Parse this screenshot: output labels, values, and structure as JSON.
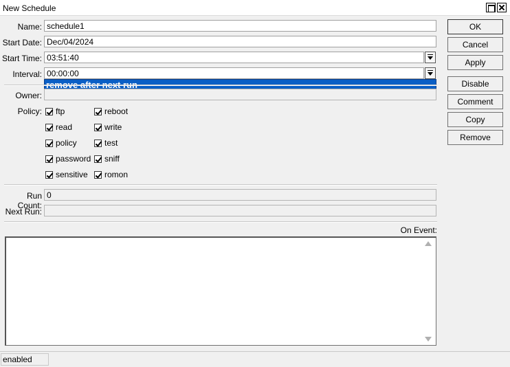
{
  "window": {
    "title": "New Schedule"
  },
  "form": {
    "name": {
      "label": "Name:",
      "value": "schedule1"
    },
    "start_date": {
      "label": "Start Date:",
      "value": "Dec/04/2024"
    },
    "start_time": {
      "label": "Start Time:",
      "value": "03:51:40"
    },
    "interval": {
      "label": "Interval:",
      "value": "00:00:00"
    },
    "interval_option": "remove after next run",
    "owner": {
      "label": "Owner:",
      "value": ""
    },
    "policy": {
      "label": "Policy:",
      "items": [
        {
          "label": "ftp",
          "checked": true
        },
        {
          "label": "reboot",
          "checked": true
        },
        {
          "label": "read",
          "checked": true
        },
        {
          "label": "write",
          "checked": true
        },
        {
          "label": "policy",
          "checked": true
        },
        {
          "label": "test",
          "checked": true
        },
        {
          "label": "password",
          "checked": true
        },
        {
          "label": "sniff",
          "checked": true
        },
        {
          "label": "sensitive",
          "checked": true
        },
        {
          "label": "romon",
          "checked": true
        }
      ]
    },
    "run_count": {
      "label": "Run Count:",
      "value": "0"
    },
    "next_run": {
      "label": "Next Run:",
      "value": ""
    },
    "on_event": {
      "label": "On Event:",
      "value": ""
    }
  },
  "buttons": {
    "ok": "OK",
    "cancel": "Cancel",
    "apply": "Apply",
    "disable": "Disable",
    "comment": "Comment",
    "copy": "Copy",
    "remove": "Remove"
  },
  "status": {
    "text": "enabled"
  }
}
